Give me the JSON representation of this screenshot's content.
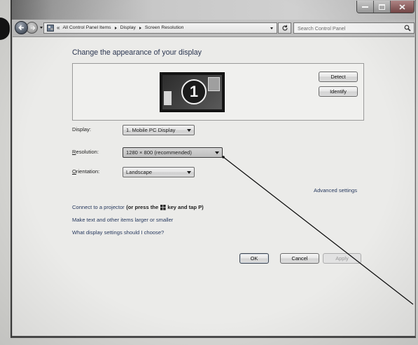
{
  "theme": {
    "heading_color": "#2a3550",
    "link_color": "#27395e",
    "text_color": "#1e1e1e"
  },
  "icons": {
    "window_controls": [
      "minimize-icon",
      "maximize-icon",
      "close-icon"
    ],
    "navigation": [
      "back-arrow-icon",
      "forward-arrow-icon",
      "recent-pages-dropdown-icon",
      "refresh-icon",
      "search-icon"
    ],
    "address": [
      "control-panel-icon",
      "chevron-right-icon",
      "address-dropdown-icon"
    ],
    "combobox": "dropdown-arrow-icon",
    "projector_hint": "windows-logo-icon"
  },
  "address_bar": {
    "overflow": "«",
    "breadcrumb": [
      "All Control Panel Items",
      "Display",
      "Screen Resolution"
    ]
  },
  "search": {
    "placeholder": "Search Control Panel"
  },
  "content": {
    "heading": "Change the appearance of your display",
    "preview": {
      "monitor_number": "1",
      "detect_label": "Detect",
      "identify_label": "Identify"
    },
    "settings": [
      {
        "label": "Display:",
        "value": "1. Mobile PC Display"
      },
      {
        "label": "Resolution:",
        "value": "1280 × 800 (recommended)"
      },
      {
        "label": "Orientation:",
        "value": "Landscape"
      }
    ],
    "advanced_settings": "Advanced settings",
    "projector": {
      "link": "Connect to a projector",
      "hint_before": "(or press the",
      "hint_after": "key and tap P)"
    },
    "links": [
      "Make text and other items larger or smaller",
      "What display settings should I choose?"
    ],
    "buttons": {
      "ok": "OK",
      "cancel": "Cancel",
      "apply": "Apply",
      "apply_enabled": false
    }
  }
}
